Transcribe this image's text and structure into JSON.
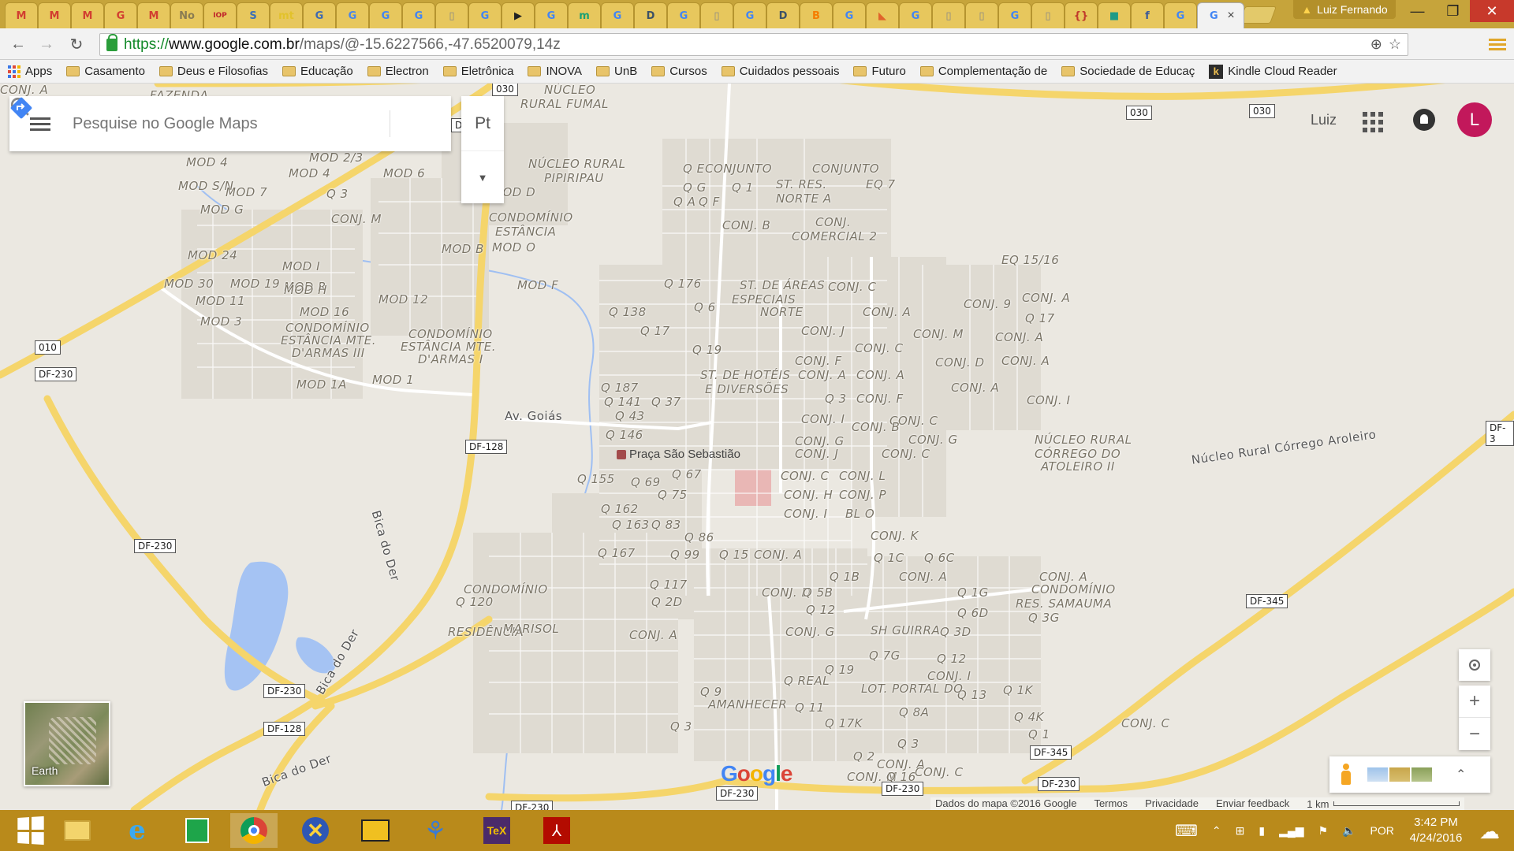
{
  "window": {
    "profile_name": "Luiz Fernando",
    "tabs": [
      {
        "icon": "gmail-icon",
        "glyph": "M",
        "color": "#d23f31"
      },
      {
        "icon": "gmail-icon",
        "glyph": "M",
        "color": "#d23f31"
      },
      {
        "icon": "gmail-icon",
        "glyph": "M",
        "color": "#d23f31"
      },
      {
        "icon": "google-plus-icon",
        "glyph": "G",
        "color": "#d23f31"
      },
      {
        "icon": "gmail-icon",
        "glyph": "M",
        "color": "#d23f31"
      },
      {
        "icon": "text-tab-icon",
        "glyph": "No",
        "color": "#8a7c52"
      },
      {
        "icon": "iop-icon",
        "glyph": "IOP",
        "color": "#c0262b"
      },
      {
        "icon": "settings-site-icon",
        "glyph": "S",
        "color": "#3d6fb6"
      },
      {
        "icon": "mt-icon",
        "glyph": "mt",
        "color": "#e2c22b"
      },
      {
        "icon": "site-icon",
        "glyph": "G",
        "color": "#3f6ab0"
      },
      {
        "icon": "translate-icon",
        "glyph": "G",
        "color": "#4a86e8"
      },
      {
        "icon": "google-icon",
        "glyph": "G",
        "color": "#4285f4"
      },
      {
        "icon": "google-icon",
        "glyph": "G",
        "color": "#4285f4"
      },
      {
        "icon": "document-icon",
        "glyph": "▯",
        "color": "#888"
      },
      {
        "icon": "google-icon",
        "glyph": "G",
        "color": "#4285f4"
      },
      {
        "icon": "play-icon",
        "glyph": "▶",
        "color": "#222"
      },
      {
        "icon": "google-icon",
        "glyph": "G",
        "color": "#4285f4"
      },
      {
        "icon": "m-icon",
        "glyph": "m",
        "color": "#1aa174"
      },
      {
        "icon": "google-icon",
        "glyph": "G",
        "color": "#4285f4"
      },
      {
        "icon": "d-icon",
        "glyph": "D",
        "color": "#3c5166"
      },
      {
        "icon": "google-icon",
        "glyph": "G",
        "color": "#4285f4"
      },
      {
        "icon": "document-icon",
        "glyph": "▯",
        "color": "#888"
      },
      {
        "icon": "google-icon",
        "glyph": "G",
        "color": "#4285f4"
      },
      {
        "icon": "d-icon",
        "glyph": "D",
        "color": "#3c5166"
      },
      {
        "icon": "blogger-icon",
        "glyph": "B",
        "color": "#f57d00"
      },
      {
        "icon": "google-icon",
        "glyph": "G",
        "color": "#4285f4"
      },
      {
        "icon": "flag-icon",
        "glyph": "◣",
        "color": "#e0642b"
      },
      {
        "icon": "google-icon",
        "glyph": "G",
        "color": "#4285f4"
      },
      {
        "icon": "document-icon",
        "glyph": "▯",
        "color": "#888"
      },
      {
        "icon": "document-icon",
        "glyph": "▯",
        "color": "#888"
      },
      {
        "icon": "google-icon",
        "glyph": "G",
        "color": "#4285f4"
      },
      {
        "icon": "document-icon",
        "glyph": "▯",
        "color": "#888"
      },
      {
        "icon": "braces-icon",
        "glyph": "{}",
        "color": "#c0392b"
      },
      {
        "icon": "square-icon",
        "glyph": "■",
        "color": "#1e9a86"
      },
      {
        "icon": "facebook-icon",
        "glyph": "f",
        "color": "#3b5998"
      },
      {
        "icon": "google-icon",
        "glyph": "G",
        "color": "#4285f4"
      }
    ],
    "active_tab_close": "×",
    "controls": {
      "minimize": "—",
      "restore": "❐",
      "close": "✕"
    }
  },
  "toolbar": {
    "url_scheme": "https://",
    "url_host": "www.google.com.br",
    "url_path": "/maps/@-15.6227566,-47.6520079,14z"
  },
  "bookmarks": [
    {
      "label": "Apps",
      "kind": "apps"
    },
    {
      "label": "Casamento",
      "kind": "folder"
    },
    {
      "label": "Deus e Filosofias",
      "kind": "folder"
    },
    {
      "label": "Educação",
      "kind": "folder"
    },
    {
      "label": "Electron",
      "kind": "folder"
    },
    {
      "label": "Eletrônica",
      "kind": "folder"
    },
    {
      "label": "INOVA",
      "kind": "folder"
    },
    {
      "label": "UnB",
      "kind": "folder"
    },
    {
      "label": "Cursos",
      "kind": "folder"
    },
    {
      "label": "Cuidados pessoais",
      "kind": "folder"
    },
    {
      "label": "Futuro",
      "kind": "folder"
    },
    {
      "label": "Complementação de",
      "kind": "folder"
    },
    {
      "label": "Sociedade de Educaç",
      "kind": "folder"
    },
    {
      "label": "Kindle Cloud Reader",
      "kind": "kindle"
    }
  ],
  "maps": {
    "search_placeholder": "Pesquise no Google Maps",
    "language_button": "Pt",
    "account_name": "Luiz",
    "avatar_letter": "L",
    "earth_label": "Earth",
    "google_logo": "Google",
    "attribution": "Dados do mapa ©2016 Google",
    "terms": "Termos",
    "privacy": "Privacidade",
    "feedback": "Enviar feedback",
    "scale": "1 km",
    "poi": "Praça São Sebastião",
    "road_names": [
      "Av. Goiás",
      "Bica do Der",
      "Bica do Der",
      "Bica do Der",
      "Núcleo Rural Córrego Aroleiro"
    ],
    "shields": [
      "030",
      "030",
      "030",
      "010",
      "DF-230",
      "DF-128",
      "DF-230",
      "DF-230",
      "DF-128",
      "DF-345",
      "DF-345",
      "DF-230",
      "DF-230",
      "DF-230",
      "DF-3",
      "DF-230",
      "DF"
    ],
    "area_labels": [
      "NÚCLEO",
      "RURAL FUMAL",
      "FAZENDA",
      "NÚCLEO RURAL",
      "PIPIRIPAU",
      "MOD 4",
      "MOD 2/3",
      "MOD S/N",
      "MOD 4",
      "MOD 6",
      "MOD 7",
      "Q 3",
      "MOD D",
      "MOD G",
      "CONJ. M",
      "CONDOMÍNIO",
      "ESTÂNCIA",
      "MOD B",
      "MOD O",
      "MOD 24",
      "MOD I",
      "MOD R",
      "MOD 30",
      "MOD 19",
      "MOD H",
      "MOD F",
      "MOD 11",
      "MOD 16",
      "MOD 12",
      "MOD 3",
      "CONDOMÍNIO",
      "ESTÂNCIA MTE.",
      "D'ARMAS III",
      "CONDOMÍNIO",
      "ESTÂNCIA MTE.",
      "D'ARMAS I",
      "MOD 1A",
      "MOD 1",
      "Q E",
      "CONJUNTO",
      "CONJUNTO",
      "Q G",
      "Q 1",
      "ST. RES.",
      "EQ 7",
      "Q A",
      "Q F",
      "NORTE A",
      "CONJ. B",
      "CONJ.",
      "COMERCIAL 2",
      "EQ 15/16",
      "Q 176",
      "ST. DE ÁREAS",
      "CONJ. C",
      "ESPECIAIS",
      "NORTE",
      "Q 138",
      "Q 6",
      "CONJ. A",
      "CONJ. 9",
      "CONJ. A",
      "Q 17",
      "Q 17",
      "CONJ. J",
      "CONJ. M",
      "CONJ. A",
      "Q 19",
      "CONJ. C",
      "CONJ. F",
      "CONJ. D",
      "CONJ. A",
      "ST. DE HOTÉIS",
      "E DIVERSÕES",
      "CONJ. A",
      "CONJ. A",
      "CONJ. A",
      "Q 187",
      "Q 141",
      "Q 37",
      "Q 3",
      "CONJ. F",
      "CONJ. I",
      "Q 43",
      "CONJ. I",
      "CONJ. C",
      "Q 146",
      "CONJ. B",
      "CONJ. G",
      "CONJ. G",
      "CONJ. J",
      "CONJ. C",
      "NÚCLEO RURAL",
      "CÓRREGO DO",
      "ATOLEIRO II",
      "Q 155",
      "Q 69",
      "Q 67",
      "CONJ. C",
      "CONJ. L",
      "Q 75",
      "CONJ. H",
      "CONJ. P",
      "Q 162",
      "CONJ. I",
      "BL O",
      "Q 163",
      "Q 83",
      "Q 86",
      "CONJ. K",
      "Q 167",
      "Q 99",
      "Q 15",
      "CONJ. A",
      "Q 1C",
      "Q 6C",
      "CONJ. A",
      "Q 1B",
      "CONJ. A",
      "Q 117",
      "CONJ. D",
      "Q 5B",
      "Q 1G",
      "CONDOMÍNIO",
      "CONDOMÍNIO",
      "RES. SAMAUMA",
      "Q 120",
      "Q 2D",
      "Q 12",
      "Q 3G",
      "RESIDÊNCIA",
      "MARISOL",
      "CONJ. A",
      "CONJ. G",
      "SH GUIRRA",
      "Q 3D",
      "Q 6D",
      "Q 19",
      "Q 7G",
      "Q 12",
      "Q REAL",
      "Q 13",
      "LOT. PORTAL DO",
      "Q 9",
      "CONJ. I",
      "Q 1K",
      "AMANHECER",
      "Q 3",
      "Q 11",
      "Q 8A",
      "Q 4K",
      "Q 17K",
      "CONJ. C",
      "Q 3",
      "Q 1",
      "CONJ. A",
      "Q 2",
      "CONJ. C",
      "CONJ. M",
      "Q 16",
      "CONJ. A"
    ]
  },
  "taskbar": {
    "apps": [
      "start-icon",
      "file-explorer-icon",
      "internet-explorer-icon",
      "store-icon",
      "chrome-icon",
      "app-x-icon",
      "reader-icon",
      "app-figure-icon",
      "tex-icon",
      "pdf-icon"
    ],
    "tray_lang": "POR",
    "time": "3:42 PM",
    "date": "4/24/2016"
  }
}
